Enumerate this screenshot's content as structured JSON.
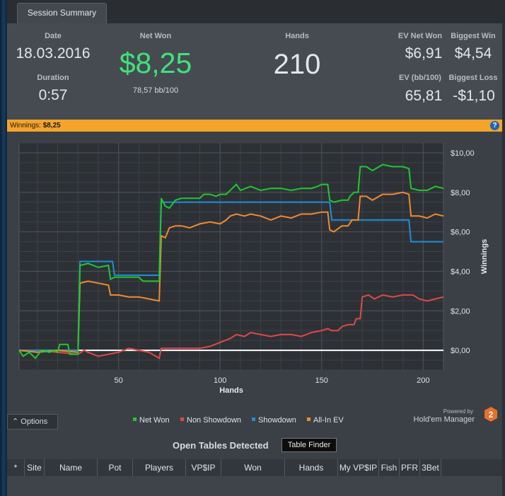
{
  "tab": {
    "label": "Session Summary"
  },
  "summary": {
    "date_label": "Date",
    "date_value": "18.03.2016",
    "duration_label": "Duration",
    "duration_value": "0:57",
    "net_won_label": "Net Won",
    "net_won_value": "$8,25",
    "net_won_bb": "78,57 bb/100",
    "hands_label": "Hands",
    "hands_value": "210",
    "ev_net_won_label": "EV Net Won",
    "ev_net_won_value": "$6,91",
    "biggest_win_label": "Biggest Win",
    "biggest_win_value": "$4,54",
    "ev_bb_label": "EV (bb/100)",
    "ev_bb_value": "65,81",
    "biggest_loss_label": "Biggest Loss",
    "biggest_loss_value": "-$1,10"
  },
  "winbar": {
    "label": "Winnings:",
    "value": "$8,25",
    "help": "?"
  },
  "chart_data": {
    "type": "line",
    "xlabel": "Hands",
    "ylabel": "Winnings",
    "xlim": [
      1,
      210
    ],
    "ylim": [
      -1.0,
      10.5
    ],
    "x_ticks": [
      50,
      100,
      150,
      200
    ],
    "y_ticks": [
      0,
      2,
      4,
      6,
      8,
      10
    ],
    "y_tick_labels": [
      "$0,00",
      "$2,00",
      "$4,00",
      "$6,00",
      "$8,00",
      "$10,00"
    ],
    "grid": true,
    "legend_position": "bottom",
    "series": [
      {
        "name": "Net Won",
        "color": "#20c830",
        "points": [
          [
            1,
            0
          ],
          [
            3,
            -0.3
          ],
          [
            6,
            -0.1
          ],
          [
            9,
            -0.4
          ],
          [
            12,
            0
          ],
          [
            16,
            -0.1
          ],
          [
            18,
            0
          ],
          [
            20,
            -0.1
          ],
          [
            21,
            0.3
          ],
          [
            25,
            0.3
          ],
          [
            26,
            -0.2
          ],
          [
            30,
            -0.2
          ],
          [
            31,
            4.3
          ],
          [
            35,
            4.4
          ],
          [
            40,
            4.2
          ],
          [
            45,
            4.3
          ],
          [
            46,
            3.6
          ],
          [
            48,
            3.7
          ],
          [
            55,
            3.7
          ],
          [
            60,
            3.7
          ],
          [
            62,
            3.5
          ],
          [
            70,
            3.5
          ],
          [
            71,
            7.7
          ],
          [
            73,
            7.3
          ],
          [
            75,
            7.2
          ],
          [
            78,
            7.6
          ],
          [
            81,
            7.7
          ],
          [
            85,
            7.7
          ],
          [
            90,
            7.7
          ],
          [
            92,
            7.9
          ],
          [
            95,
            7.9
          ],
          [
            98,
            7.8
          ],
          [
            100,
            7.9
          ],
          [
            103,
            7.9
          ],
          [
            106,
            8.2
          ],
          [
            108,
            8.4
          ],
          [
            110,
            8.1
          ],
          [
            115,
            8.3
          ],
          [
            120,
            8.1
          ],
          [
            125,
            8.2
          ],
          [
            130,
            8.2
          ],
          [
            135,
            8.1
          ],
          [
            140,
            8.2
          ],
          [
            145,
            8.2
          ],
          [
            148,
            8.3
          ],
          [
            150,
            8.4
          ],
          [
            153,
            8.4
          ],
          [
            154,
            7.6
          ],
          [
            156,
            7.5
          ],
          [
            160,
            7.6
          ],
          [
            163,
            7.6
          ],
          [
            164,
            7.8
          ],
          [
            166,
            8.0
          ],
          [
            168,
            8.0
          ],
          [
            169,
            9.3
          ],
          [
            172,
            9.3
          ],
          [
            175,
            9.1
          ],
          [
            180,
            9.4
          ],
          [
            185,
            9.3
          ],
          [
            190,
            9.3
          ],
          [
            193,
            9.2
          ],
          [
            194,
            8.2
          ],
          [
            198,
            8.1
          ],
          [
            202,
            8.1
          ],
          [
            206,
            8.3
          ],
          [
            210,
            8.2
          ]
        ]
      },
      {
        "name": "Non Showdown",
        "color": "#e04848",
        "points": [
          [
            1,
            0
          ],
          [
            10,
            0
          ],
          [
            20,
            -0.1
          ],
          [
            30,
            -0.2
          ],
          [
            33,
            0
          ],
          [
            35,
            -0.1
          ],
          [
            40,
            -0.3
          ],
          [
            45,
            -0.2
          ],
          [
            50,
            -0.1
          ],
          [
            55,
            0.1
          ],
          [
            60,
            0
          ],
          [
            65,
            -0.1
          ],
          [
            70,
            -0.4
          ],
          [
            71,
            0.1
          ],
          [
            75,
            0.1
          ],
          [
            80,
            0.1
          ],
          [
            90,
            0.1
          ],
          [
            95,
            0.2
          ],
          [
            100,
            0.4
          ],
          [
            105,
            0.6
          ],
          [
            108,
            0.8
          ],
          [
            112,
            0.7
          ],
          [
            115,
            0.9
          ],
          [
            120,
            0.8
          ],
          [
            125,
            0.7
          ],
          [
            130,
            0.8
          ],
          [
            135,
            0.8
          ],
          [
            140,
            0.7
          ],
          [
            145,
            0.9
          ],
          [
            150,
            1.0
          ],
          [
            153,
            1.1
          ],
          [
            155,
            1.0
          ],
          [
            158,
            1.0
          ],
          [
            160,
            1.2
          ],
          [
            163,
            1.3
          ],
          [
            166,
            1.3
          ],
          [
            167,
            1.6
          ],
          [
            169,
            1.6
          ],
          [
            170,
            2.7
          ],
          [
            173,
            2.8
          ],
          [
            176,
            2.6
          ],
          [
            180,
            2.8
          ],
          [
            185,
            2.7
          ],
          [
            190,
            2.8
          ],
          [
            195,
            2.8
          ],
          [
            198,
            2.6
          ],
          [
            202,
            2.5
          ],
          [
            206,
            2.6
          ],
          [
            210,
            2.7
          ]
        ]
      },
      {
        "name": "Showdown",
        "color": "#1f8ed8",
        "points": [
          [
            1,
            0
          ],
          [
            30,
            0
          ],
          [
            31,
            4.5
          ],
          [
            47,
            4.5
          ],
          [
            48,
            3.8
          ],
          [
            70,
            3.8
          ],
          [
            71,
            7.5
          ],
          [
            150,
            7.5
          ],
          [
            154,
            7.5
          ],
          [
            155,
            6.6
          ],
          [
            193,
            6.6
          ],
          [
            194,
            5.5
          ],
          [
            210,
            5.5
          ]
        ]
      },
      {
        "name": "All-In EV",
        "color": "#f08a30",
        "points": [
          [
            1,
            0
          ],
          [
            10,
            -0.1
          ],
          [
            20,
            0
          ],
          [
            30,
            -0.1
          ],
          [
            31,
            3.4
          ],
          [
            35,
            3.5
          ],
          [
            40,
            3.4
          ],
          [
            45,
            3.3
          ],
          [
            46,
            2.8
          ],
          [
            50,
            2.8
          ],
          [
            55,
            2.7
          ],
          [
            60,
            2.7
          ],
          [
            65,
            2.6
          ],
          [
            70,
            2.5
          ],
          [
            71,
            5.8
          ],
          [
            73,
            5.7
          ],
          [
            75,
            6.2
          ],
          [
            78,
            6.3
          ],
          [
            81,
            6.3
          ],
          [
            85,
            6.2
          ],
          [
            90,
            6.4
          ],
          [
            95,
            6.5
          ],
          [
            100,
            6.4
          ],
          [
            103,
            6.6
          ],
          [
            105,
            6.8
          ],
          [
            108,
            6.9
          ],
          [
            112,
            6.8
          ],
          [
            115,
            6.9
          ],
          [
            120,
            6.8
          ],
          [
            125,
            6.6
          ],
          [
            130,
            6.8
          ],
          [
            135,
            6.7
          ],
          [
            140,
            6.9
          ],
          [
            145,
            6.9
          ],
          [
            150,
            7.0
          ],
          [
            153,
            7.0
          ],
          [
            154,
            6.1
          ],
          [
            156,
            6.0
          ],
          [
            160,
            6.3
          ],
          [
            163,
            6.3
          ],
          [
            165,
            6.6
          ],
          [
            168,
            6.6
          ],
          [
            169,
            7.8
          ],
          [
            172,
            7.8
          ],
          [
            175,
            7.6
          ],
          [
            180,
            7.9
          ],
          [
            185,
            7.9
          ],
          [
            190,
            8.0
          ],
          [
            193,
            7.9
          ],
          [
            194,
            6.8
          ],
          [
            198,
            6.8
          ],
          [
            202,
            6.7
          ],
          [
            206,
            6.9
          ],
          [
            210,
            6.8
          ]
        ]
      }
    ]
  },
  "options": {
    "label": "Options"
  },
  "powered": {
    "line1": "Powered by",
    "line2": "Hold'em Manager",
    "badge": "2"
  },
  "open_tables": {
    "title": "Open Tables Detected",
    "finder_label": "Table Finder",
    "columns": [
      {
        "label": "*",
        "w": 25
      },
      {
        "label": "Site",
        "w": 28
      },
      {
        "label": "Name",
        "w": 75
      },
      {
        "label": "Pot",
        "w": 50
      },
      {
        "label": "Players",
        "w": 75
      },
      {
        "label": "VP$IP",
        "w": 50
      },
      {
        "label": "Won",
        "w": 90
      },
      {
        "label": "Hands",
        "w": 75
      },
      {
        "label": "My VP$IP",
        "w": 58
      },
      {
        "label": "Fish",
        "w": 29
      },
      {
        "label": "PFR",
        "w": 29
      },
      {
        "label": "3Bet",
        "w": 30
      }
    ]
  }
}
